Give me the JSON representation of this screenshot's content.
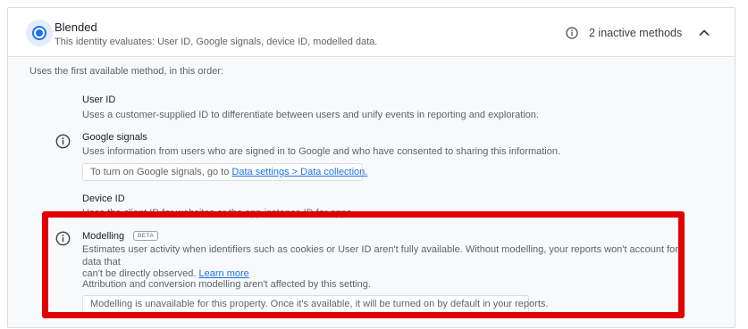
{
  "header": {
    "title": "Blended",
    "subtitle": "This identity evaluates: User ID, Google signals, device ID, modelled data.",
    "inactive_methods": "2 inactive methods"
  },
  "body": {
    "intro": "Uses the first available method, in this order:",
    "user_id": {
      "title": "User ID",
      "description": "Uses a customer-supplied ID to differentiate between users and unify events in reporting and exploration."
    },
    "google_signals": {
      "title": "Google signals",
      "description": "Uses information from users who are signed in to Google and who have consented to sharing this information.",
      "note_prefix": "To turn on Google signals, go to ",
      "note_link": "Data settings > Data collection."
    },
    "device_id": {
      "title": "Device ID",
      "description": "Uses the client ID for websites or the app instance ID for apps."
    },
    "modelling": {
      "title": "Modelling",
      "badge": "BETA",
      "description_line1": "Estimates user activity when identifiers such as cookies or User ID aren't fully available. Without modelling, your reports won't account for data that",
      "description_line2": "can't be directly observed.",
      "learn_more": "Learn more",
      "attribution_note": "Attribution and conversion modelling aren't affected by this setting.",
      "unavailable_note": "Modelling is unavailable for this property. Once it's available, it will be turned on by default in your reports."
    }
  },
  "colors": {
    "accent": "#1a73e8",
    "highlight": "#e00000"
  },
  "icons": {
    "radio": "radio-selected-icon",
    "info": "info-icon",
    "collapse": "chevron-up-icon"
  }
}
